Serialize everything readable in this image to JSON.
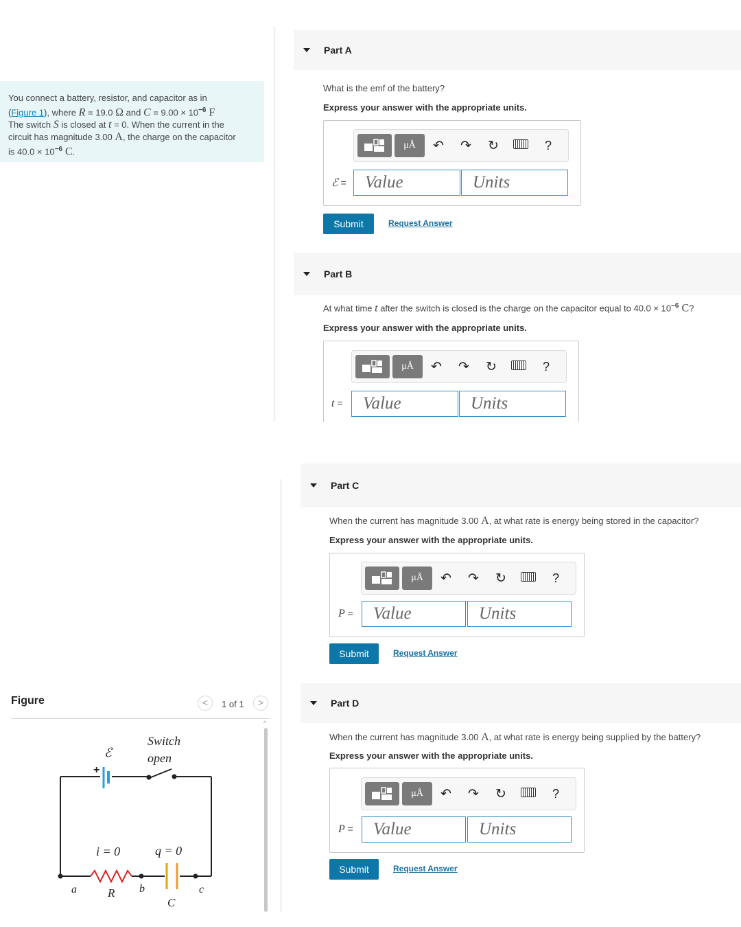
{
  "problem": {
    "line1a": "You connect a battery, resistor, and capacitor as in",
    "figure_link": "Figure 1",
    "line2a": "), where ",
    "R_sym": "R",
    "R_eq": " = 19.0 ",
    "ohm": "Ω",
    "and": " and ",
    "C_sym": "C",
    "C_eq": " = 9.00 × 10",
    "C_exp": "−6",
    "F": " F",
    "line3a": "The switch ",
    "S_sym": "S",
    "line3b": " is closed at ",
    "t_sym": "t",
    "line3c": " = 0. When the current in the",
    "line4a": "circuit has magnitude 3.00 ",
    "A": "A",
    "line4b": ", the charge on the capacitor",
    "line5a": "is 40.0 × 10",
    "q_exp": "−6",
    "Coul": " C",
    "line5b": "."
  },
  "toolbar": {
    "units_btn": "μÅ",
    "undo": "↶",
    "redo": "↷",
    "reset": "↻",
    "help": "?"
  },
  "fields": {
    "value_placeholder": "Value",
    "units_placeholder": "Units"
  },
  "submit_label": "Submit",
  "request_label": "Request Answer",
  "parts": [
    {
      "title": "Part A",
      "question": "What is the emf of the battery?",
      "hint": "Express your answer with the appropriate units.",
      "var": "ℰ",
      "eq": " ="
    },
    {
      "title": "Part B",
      "q1": "At what time ",
      "q_t": "t",
      "q2": " after the switch is closed is the charge on the capacitor equal to 40.0 × 10",
      "q_exp": "−6",
      "q_C": " C",
      "q3": "?",
      "hint": "Express your answer with the appropriate units.",
      "var": "t",
      "eq": " ="
    },
    {
      "title": "Part C",
      "q1": "When the current has magnitude 3.00 ",
      "q_A": "A",
      "q2": ", at what rate is energy being stored in the capacitor?",
      "hint": "Express your answer with the appropriate units.",
      "var": "P",
      "eq": " ="
    },
    {
      "title": "Part D",
      "q1": "When the current has magnitude 3.00 ",
      "q_A": "A",
      "q2": ", at what rate is energy being supplied by the battery?",
      "hint": "Express your answer with the appropriate units.",
      "var": "P",
      "eq": " ="
    }
  ],
  "figure": {
    "title": "Figure",
    "pager": "1 of 1",
    "prev": "<",
    "next": ">",
    "labels": {
      "emf": "ℰ",
      "plus": "+",
      "switch_line1": "Switch",
      "switch_line2": "open",
      "i0": "i = 0",
      "q0": "q = 0",
      "a": "a",
      "R": "R",
      "b": "b",
      "C": "C",
      "c": "c"
    }
  },
  "colors": {
    "submit": "#0c77a8",
    "link": "#1a6fa0",
    "field_border": "#2f8ecb",
    "problem_bg": "#e8f6f8"
  }
}
